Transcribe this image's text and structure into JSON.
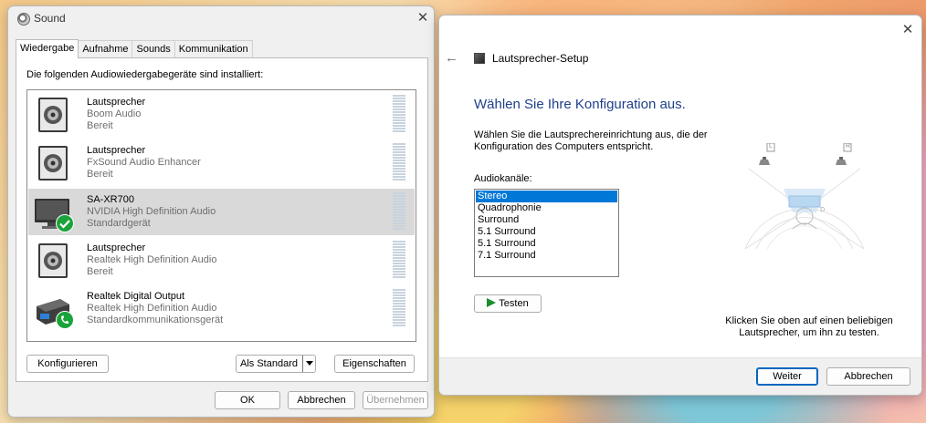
{
  "sound_dialog": {
    "title": "Sound",
    "tabs": [
      {
        "label": "Wiedergabe",
        "active": true
      },
      {
        "label": "Aufnahme",
        "active": false
      },
      {
        "label": "Sounds",
        "active": false
      },
      {
        "label": "Kommunikation",
        "active": false
      }
    ],
    "intro": "Die folgenden Audiowiedergabegeräte sind installiert:",
    "devices": [
      {
        "name": "Lautsprecher",
        "driver": "Boom Audio",
        "status": "Bereit",
        "icon": "speaker-icon",
        "selected": false
      },
      {
        "name": "Lautsprecher",
        "driver": "FxSound Audio Enhancer",
        "status": "Bereit",
        "icon": "speaker-icon",
        "selected": false
      },
      {
        "name": "SA-XR700",
        "driver": "NVIDIA High Definition Audio",
        "status": "Standardgerät",
        "icon": "monitor-icon",
        "badge": "check-icon",
        "selected": true
      },
      {
        "name": "Lautsprecher",
        "driver": "Realtek High Definition Audio",
        "status": "Bereit",
        "icon": "speaker-icon",
        "selected": false
      },
      {
        "name": "Realtek Digital Output",
        "driver": "Realtek High Definition Audio",
        "status": "Standardkommunikationsgerät",
        "icon": "digital-output-icon",
        "badge": "phone-icon",
        "selected": false
      }
    ],
    "buttons": {
      "configure": "Konfigurieren",
      "set_default": "Als Standard",
      "properties": "Eigenschaften",
      "ok": "OK",
      "cancel": "Abbrechen",
      "apply": "Übernehmen"
    }
  },
  "speaker_setup": {
    "title": "Lautsprecher-Setup",
    "heading": "Wählen Sie Ihre Konfiguration aus.",
    "description": "Wählen Sie die Lautsprechereinrichtung aus, die der Konfiguration des Computers entspricht.",
    "channels_label": "Audiokanäle:",
    "channels": [
      "Stereo",
      "Quadrophonie",
      "Surround",
      "5.1 Surround",
      "5.1 Surround",
      "7.1 Surround"
    ],
    "selected_channel": "Stereo",
    "speaker_labels": {
      "left": "L",
      "right": "R"
    },
    "test_button": "Testen",
    "hint": "Klicken Sie oben auf einen beliebigen Lautsprecher, um ihn zu testen.",
    "next_button": "Weiter",
    "cancel_button": "Abbrechen"
  },
  "colors": {
    "accent": "#0067c0",
    "selection": "#0078d7",
    "heading": "#1f3f8a",
    "status_green": "#1aa33a"
  }
}
